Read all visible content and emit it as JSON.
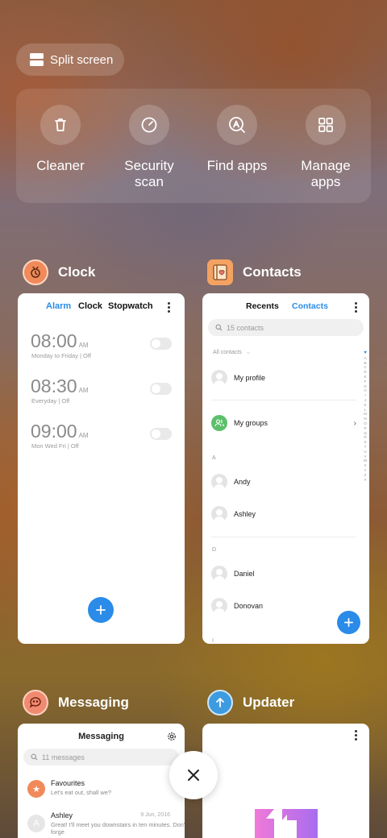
{
  "split_screen": {
    "label": "Split screen"
  },
  "tools": [
    {
      "label": "Cleaner",
      "icon": "trash-icon"
    },
    {
      "label": "Security\nscan",
      "icon": "security-gauge-icon"
    },
    {
      "label": "Find apps",
      "icon": "find-apps-icon"
    },
    {
      "label": "Manage\napps",
      "icon": "grid-icon"
    }
  ],
  "apps": {
    "clock": {
      "name": "Clock",
      "tabs": [
        "Alarm",
        "Clock",
        "Stopwatch"
      ],
      "alarms": [
        {
          "time": "08:00",
          "ampm": "AM",
          "repeat": "Monday to Friday | Off"
        },
        {
          "time": "08:30",
          "ampm": "AM",
          "repeat": "Everyday | Off"
        },
        {
          "time": "09:00",
          "ampm": "AM",
          "repeat": "Mon Wed Fri | Off"
        }
      ],
      "accent": "#2a8be8"
    },
    "contacts": {
      "name": "Contacts",
      "tabs": [
        "Recents",
        "Contacts"
      ],
      "search_placeholder": "15 contacts",
      "filter": "All contacts",
      "my_profile": "My profile",
      "my_groups": "My groups",
      "sections": [
        {
          "letter": "A",
          "names": [
            "Andy",
            "Ashley"
          ]
        },
        {
          "letter": "D",
          "names": [
            "Daniel",
            "Donovan"
          ]
        }
      ],
      "alpha_index": [
        "A",
        "B",
        "C",
        "D",
        "E",
        "F",
        "G",
        "H",
        "I",
        "J",
        "K",
        "L",
        "M",
        "N",
        "O",
        "P",
        "Q",
        "R",
        "S",
        "T",
        "U",
        "V",
        "W",
        "X",
        "Y",
        "Z",
        "#"
      ],
      "more_letter": "I"
    },
    "messaging": {
      "name": "Messaging",
      "title": "Messaging",
      "search_placeholder": "11 messages",
      "threads": [
        {
          "name": "Favourites",
          "snippet": "Let's eat out, shall we?",
          "date": ""
        },
        {
          "name": "Ashley",
          "snippet": "Great! I'll meet you downstairs in ten minutes. Don't forge",
          "date": "9 Jun, 2016"
        }
      ]
    },
    "updater": {
      "name": "Updater"
    }
  },
  "close": {
    "icon": "close-icon"
  }
}
